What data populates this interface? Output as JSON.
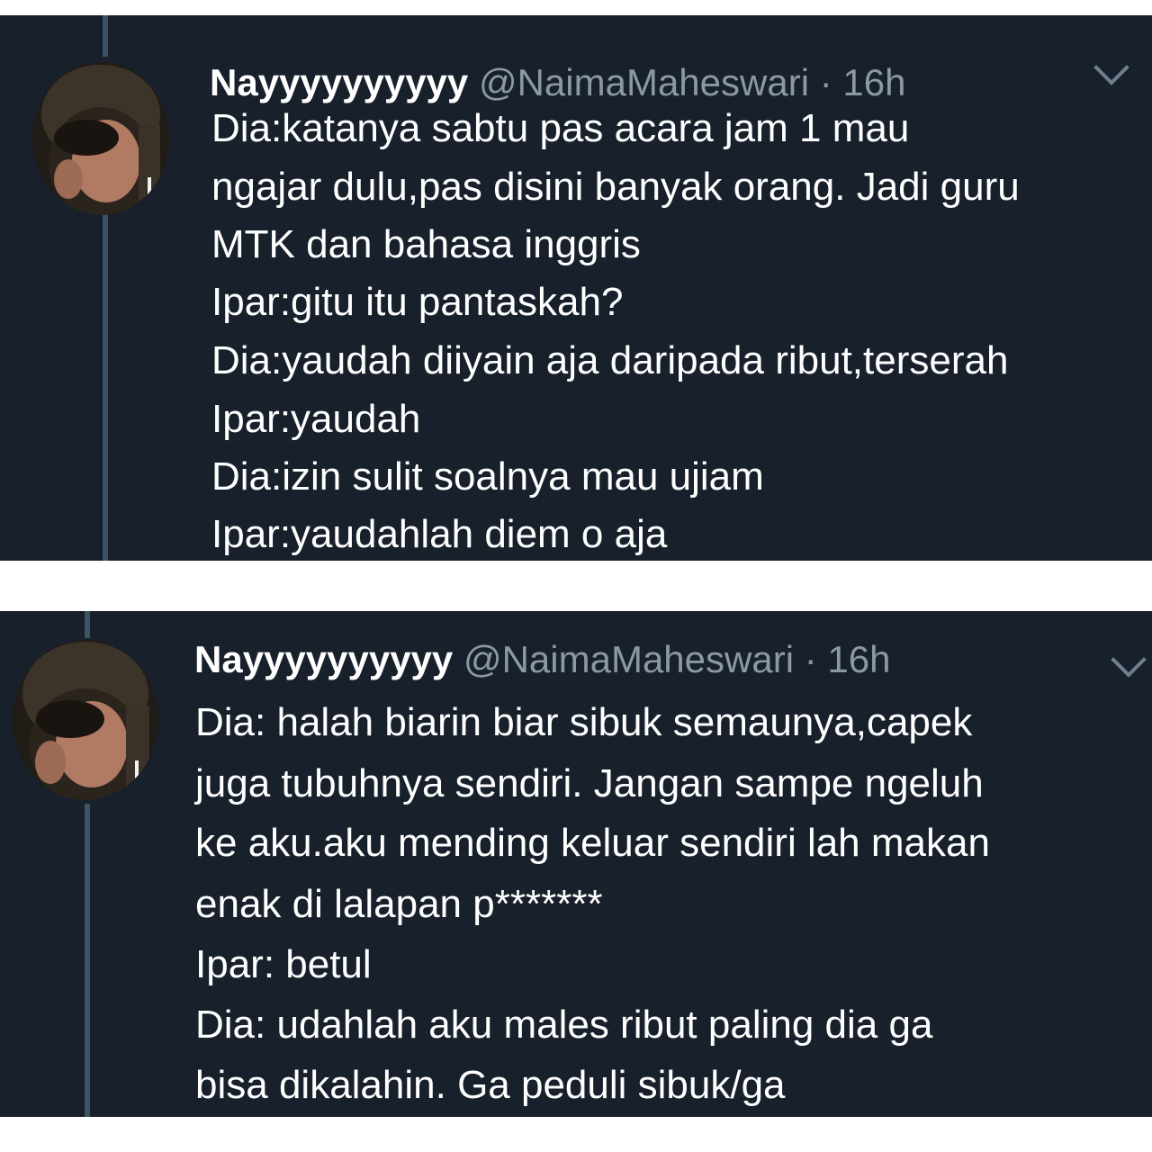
{
  "tweets": [
    {
      "display_name": "Nayyyyyyyyyy",
      "handle": "@NaimaMaheswari",
      "separator": "·",
      "time": "16h",
      "lines": [
        "Dia:katanya sabtu pas acara jam 1 mau",
        "ngajar dulu,pas disini banyak orang. Jadi guru",
        "MTK dan bahasa inggris",
        "Ipar:gitu itu pantaskah?",
        "Dia:yaudah diiyain aja daripada ribut,terserah",
        "Ipar:yaudah",
        "Dia:izin sulit soalnya mau ujiam",
        "Ipar:yaudahlah diem o aja"
      ]
    },
    {
      "display_name": "Nayyyyyyyyyy",
      "handle": "@NaimaMaheswari",
      "separator": "·",
      "time": "16h",
      "lines": [
        "Dia: halah biarin biar sibuk semaunya,capek",
        "juga tubuhnya sendiri. Jangan sampe ngeluh",
        "ke aku.aku mending keluar sendiri lah makan",
        "enak di lalapan p*******",
        "Ipar: betul",
        "Dia: udahlah aku males ribut paling dia ga",
        "bisa dikalahin. Ga peduli sibuk/ga"
      ]
    }
  ],
  "icons": {
    "avatar": "profile-photo",
    "menu": "chevron-down-icon"
  },
  "colors": {
    "background": "#17202b",
    "text": "#ffffff",
    "muted": "#8b98a5",
    "thread_line": "#3d5466"
  }
}
